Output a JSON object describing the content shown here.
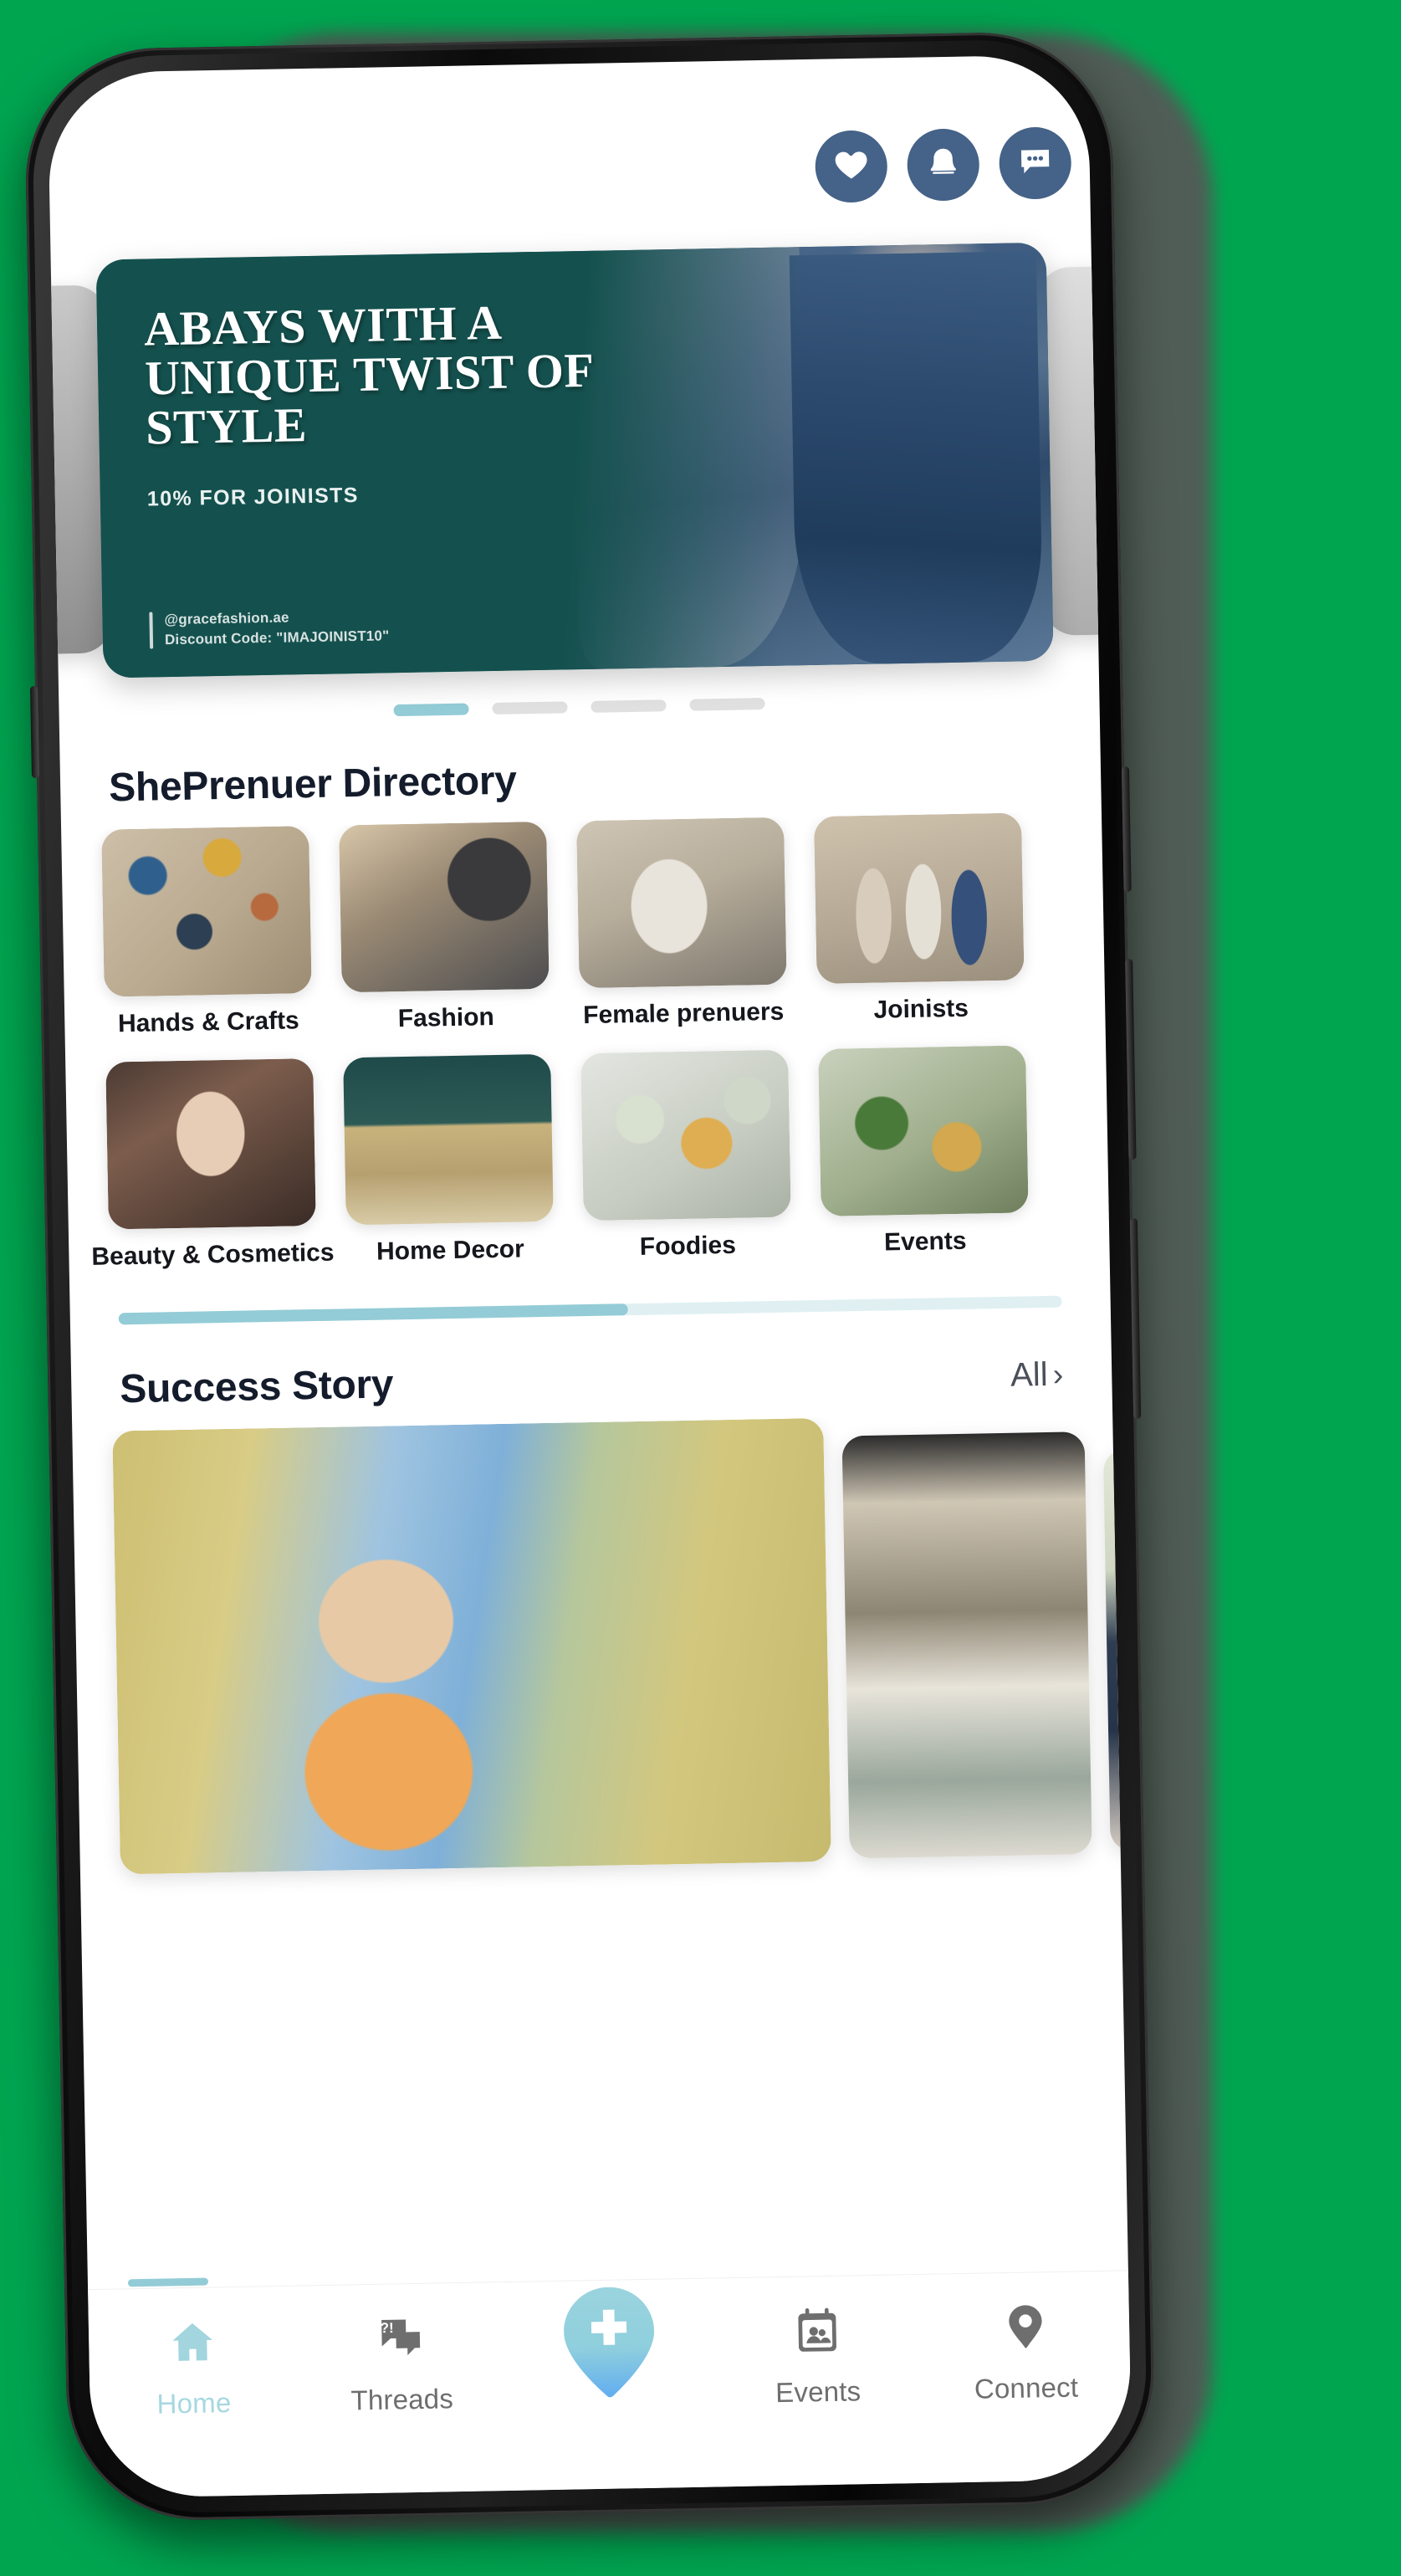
{
  "header": {
    "icons": [
      {
        "name": "heart-icon",
        "label": "Favorites"
      },
      {
        "name": "bell-icon",
        "label": "Notifications"
      },
      {
        "name": "chat-icon",
        "label": "Messages"
      }
    ]
  },
  "banner": {
    "title": "ABAYS WITH A UNIQUE TWIST OF STYLE",
    "subtitle": "10% FOR JOINISTS",
    "handle": "@gracefashion.ae",
    "discount": "Discount Code: \"IMAJOINIST10\"",
    "background_color": "#14514e"
  },
  "carousel": {
    "dots": [
      {
        "active": true
      },
      {
        "active": false
      },
      {
        "active": false
      },
      {
        "active": false
      }
    ],
    "active_color": "#93ccd6",
    "inactive_color": "#e0e0e0"
  },
  "directory": {
    "title": "ShePrenuer Directory",
    "rows": [
      [
        {
          "label": "Hands & Crafts",
          "thumb": "t-crafts"
        },
        {
          "label": "Fashion",
          "thumb": "t-fashion"
        },
        {
          "label": "Female prenuers",
          "thumb": "t-female"
        },
        {
          "label": "Joinists",
          "thumb": "t-joinists"
        }
      ],
      [
        {
          "label": "Beauty & Cosmetics",
          "thumb": "t-beauty"
        },
        {
          "label": "Home Decor",
          "thumb": "t-decor"
        },
        {
          "label": "Foodies",
          "thumb": "t-foodies"
        },
        {
          "label": "Events",
          "thumb": "t-events"
        }
      ]
    ],
    "scroll_progress": "54%",
    "scroll_fill_color": "#93ccd6",
    "scroll_track_color": "#e0f0f2"
  },
  "success": {
    "title": "Success Story",
    "all_label": "All",
    "chevron": "›",
    "cards": [
      {
        "name": "story-card-1"
      },
      {
        "name": "story-card-2"
      },
      {
        "name": "story-card-3"
      }
    ]
  },
  "bottom_nav": {
    "items": [
      {
        "label": "Home",
        "icon": "home-icon",
        "active": true
      },
      {
        "label": "Threads",
        "icon": "threads-icon",
        "active": false
      },
      {
        "label": "Events",
        "icon": "calendar-icon",
        "active": false
      },
      {
        "label": "Connect",
        "icon": "location-icon",
        "active": false
      }
    ],
    "fab": {
      "icon": "plus-icon",
      "label": "Create"
    },
    "active_color": "#a6d8e0",
    "inactive_color": "#6e6e6e"
  }
}
